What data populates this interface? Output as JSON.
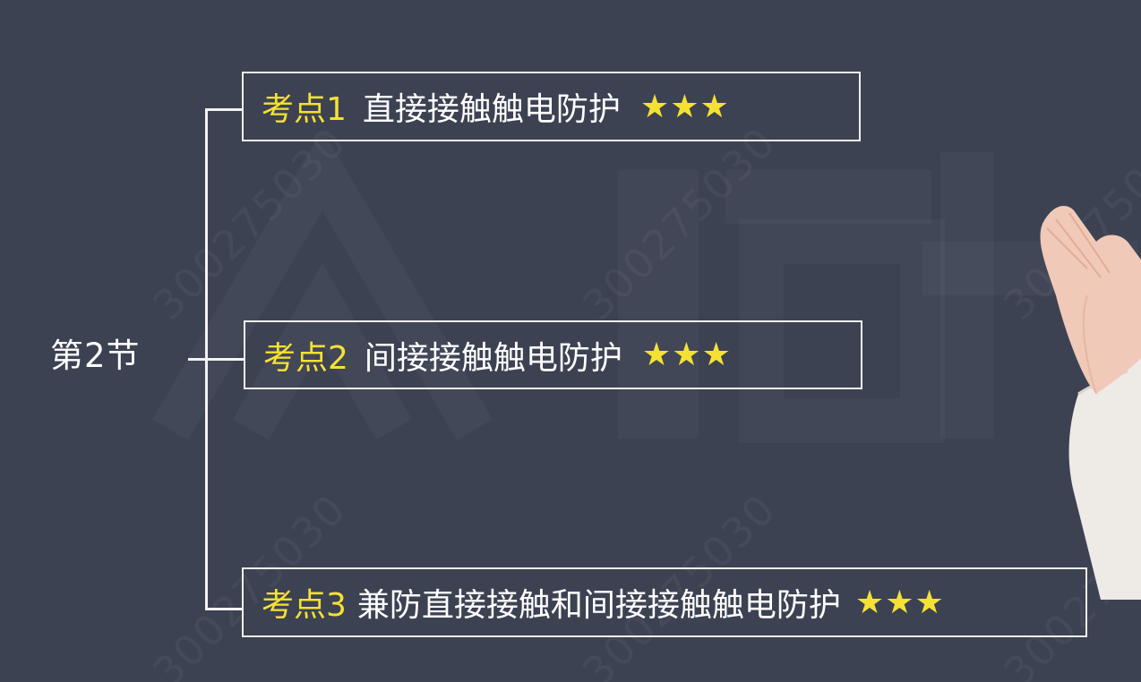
{
  "section": {
    "label": "第2节"
  },
  "topics": [
    {
      "tag": "考点1",
      "title": "直接接触触电防护",
      "stars": "★★★"
    },
    {
      "tag": "考点2",
      "title": "间接接触触电防护",
      "stars": "★★★"
    },
    {
      "tag": "考点3",
      "title": "兼防直接接触和间接接触触电防护",
      "stars": "★★★"
    }
  ],
  "watermark": {
    "text": "300275030"
  },
  "colors": {
    "background": "#3c4252",
    "accent": "#f5e133",
    "text": "#ffffff",
    "line": "#f2f2f2"
  }
}
